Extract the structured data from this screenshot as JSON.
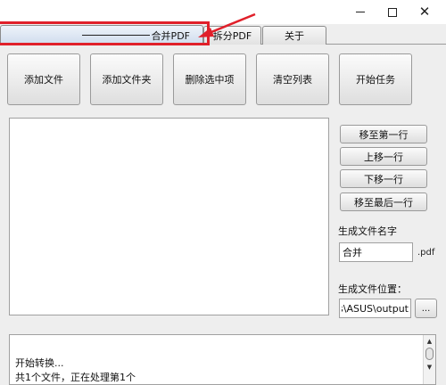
{
  "window": {
    "minimize": "—",
    "close": "✕"
  },
  "tabs": [
    {
      "label": "合并PDF",
      "active": true
    },
    {
      "label": "拆分PDF",
      "active": false
    },
    {
      "label": "关于",
      "active": false
    }
  ],
  "annotation": {
    "color": "#e0202a"
  },
  "toolbar": {
    "add_file": "添加文件",
    "add_folder": "添加文件夹",
    "delete_selected": "删除选中项",
    "clear_list": "清空列表",
    "start_task": "开始任务"
  },
  "list_controls": {
    "move_first": "移至第一行",
    "move_up": "上移一行",
    "move_down": "下移一行",
    "move_last": "移至最后一行"
  },
  "output": {
    "name_label": "生成文件名字",
    "name_value": "合并",
    "extension": ".pdf",
    "location_label": "生成文件位置：",
    "location_value": "ers\\ASUS\\output",
    "browse": "..."
  },
  "log": {
    "lines": [
      "开始转换...",
      "共1个文件，正在处理第1个"
    ]
  },
  "scroll": {
    "up": "▲",
    "down": "▼"
  }
}
